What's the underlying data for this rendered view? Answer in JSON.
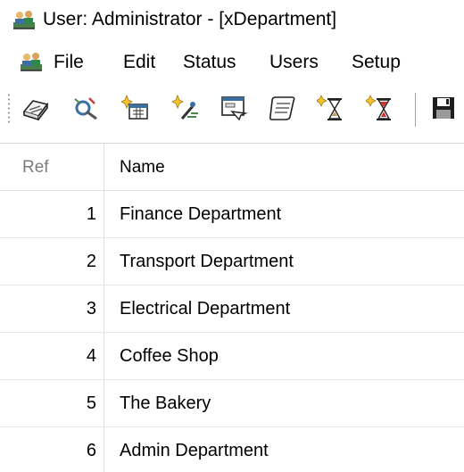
{
  "window": {
    "title": "User: Administrator - [xDepartment]",
    "app_icon": "people-app-icon"
  },
  "menubar": {
    "icon": "people-app-icon",
    "items": [
      "File",
      "Edit",
      "Status",
      "Users",
      "Setup"
    ]
  },
  "toolbar": {
    "buttons": [
      "book-icon",
      "tools-icon",
      "calendar-sparkle-icon",
      "sparkle-wand-icon",
      "window-form-icon",
      "scroll-icon",
      "hourglass-sparkle-icon",
      "hourglass-red-icon"
    ],
    "save": "save-disk-icon"
  },
  "grid": {
    "columns": [
      "Ref",
      "Name"
    ],
    "rows": [
      {
        "ref": "1",
        "name": "Finance Department"
      },
      {
        "ref": "2",
        "name": "Transport Department"
      },
      {
        "ref": "3",
        "name": "Electrical Department"
      },
      {
        "ref": "4",
        "name": "Coffee Shop"
      },
      {
        "ref": "5",
        "name": "The Bakery"
      },
      {
        "ref": "6",
        "name": "Admin Department"
      }
    ]
  }
}
